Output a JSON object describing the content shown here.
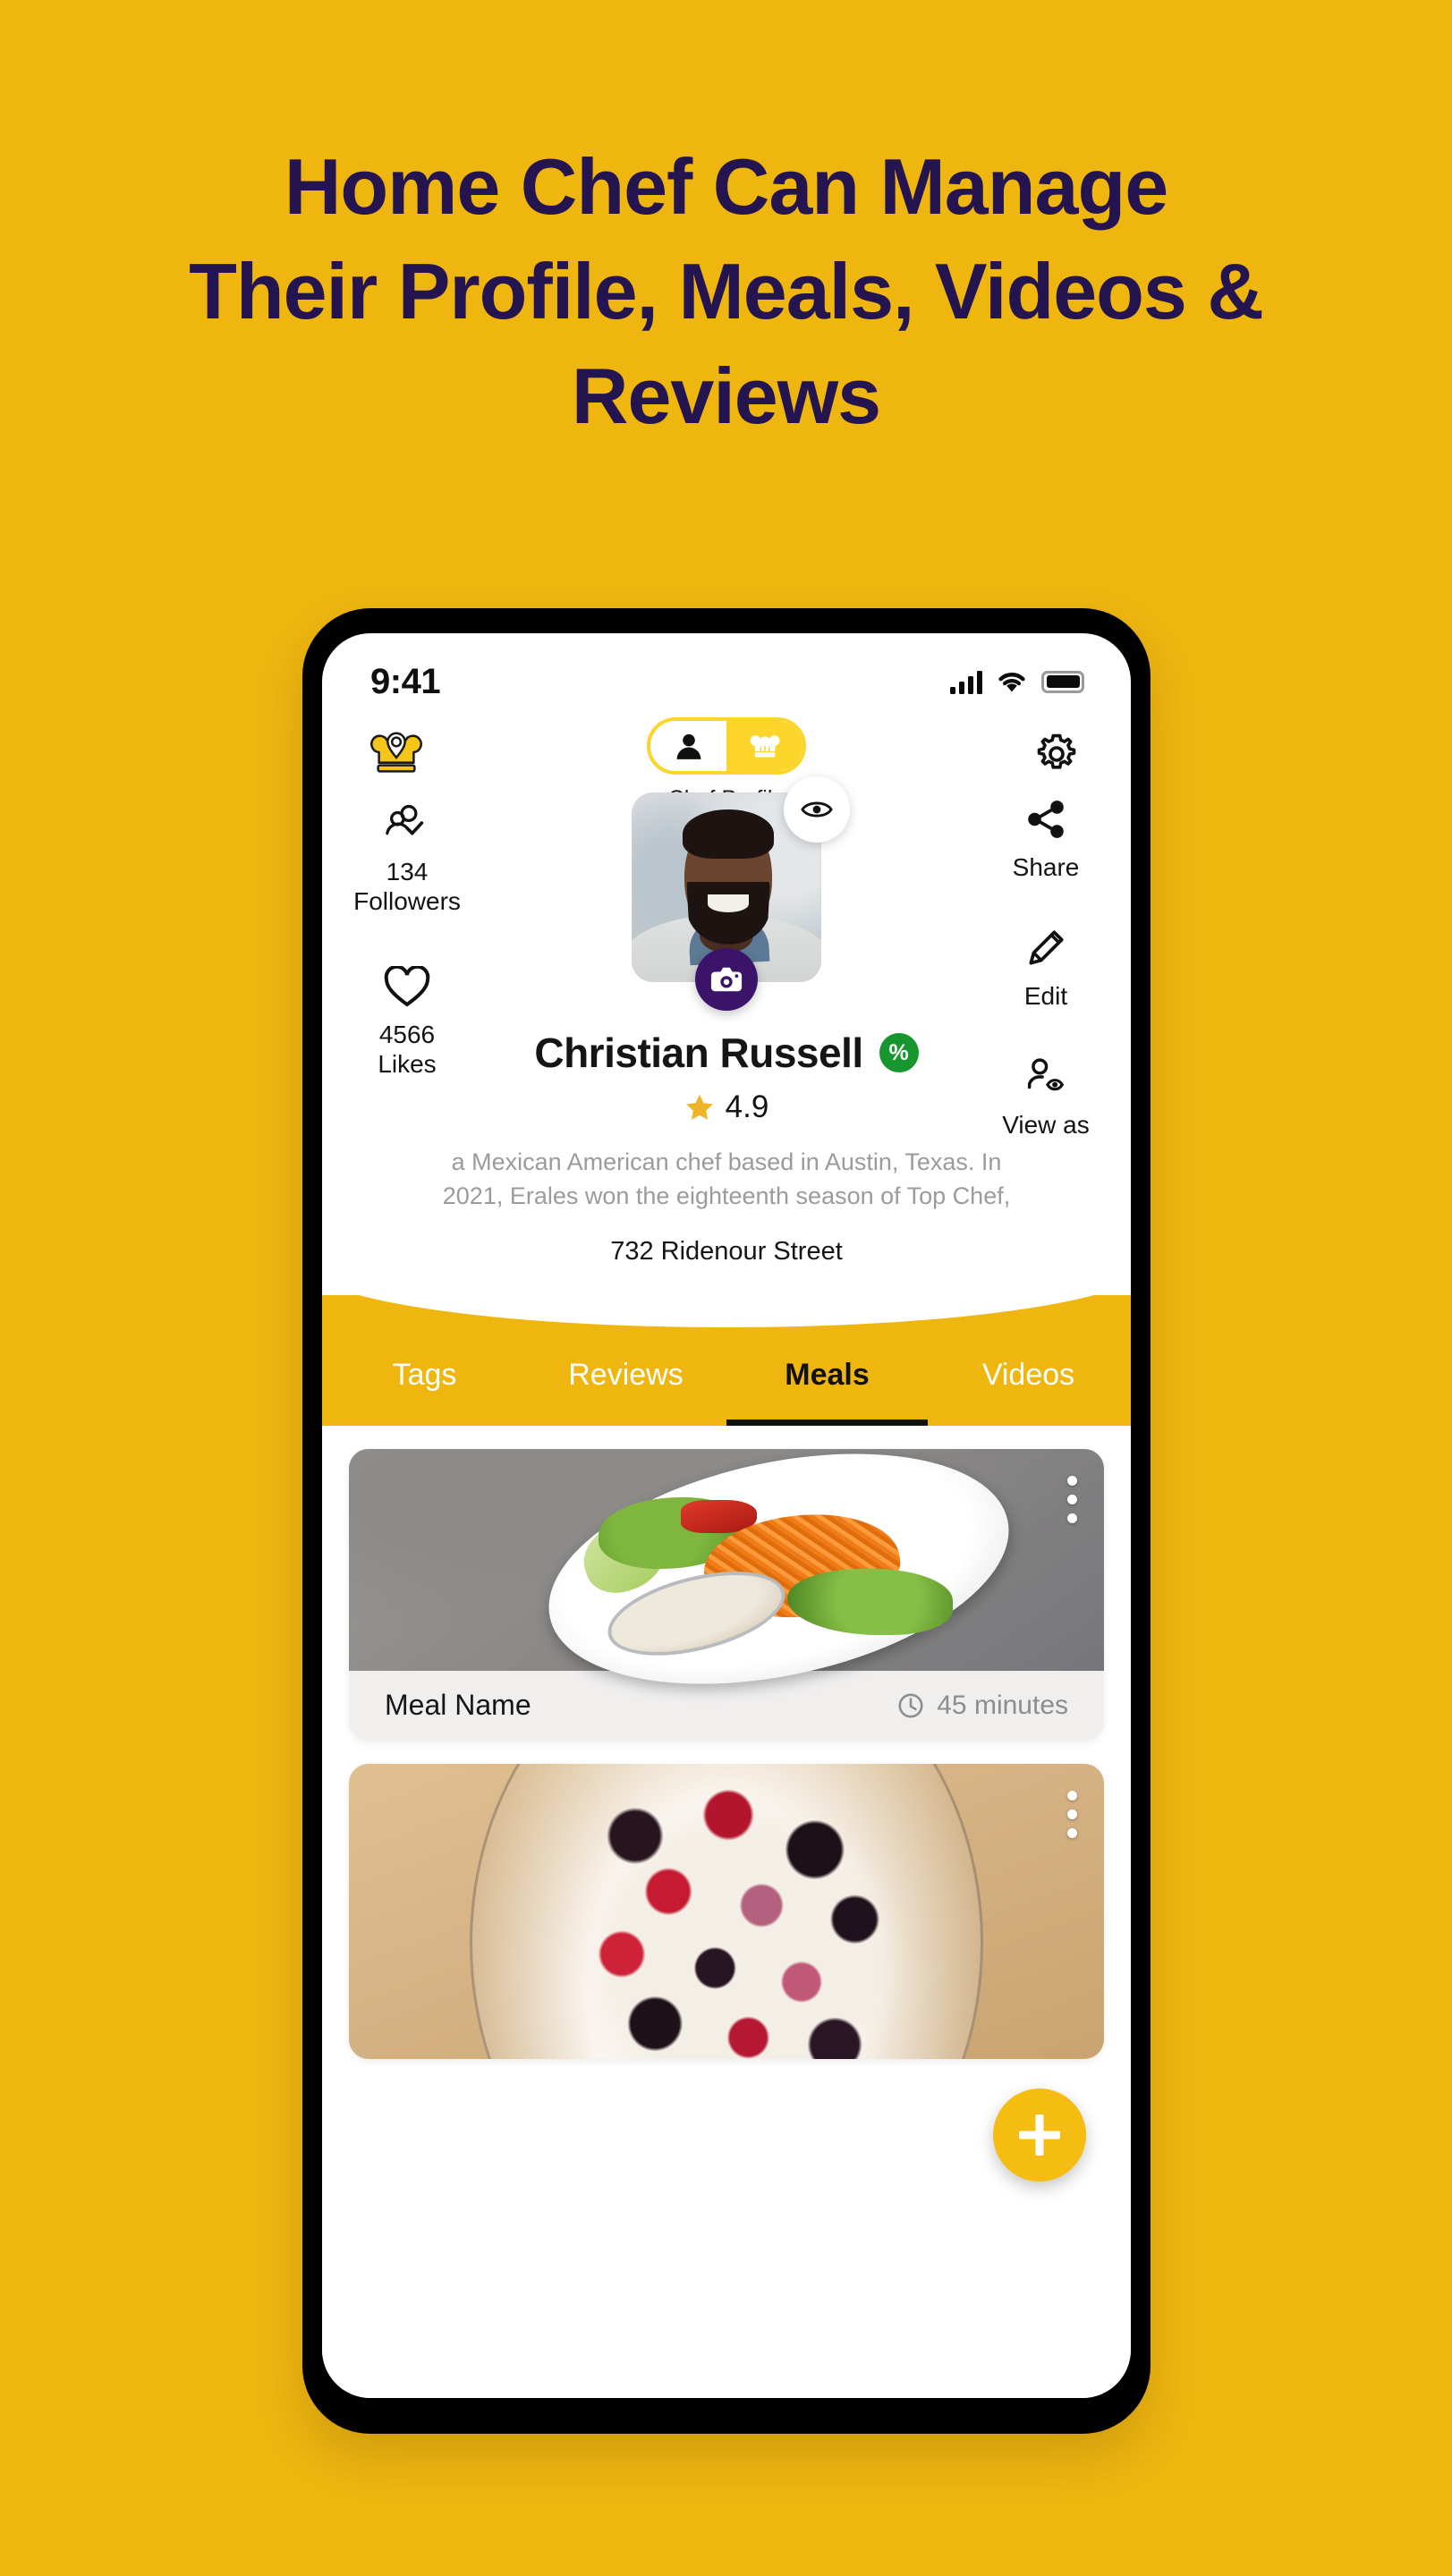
{
  "headline": {
    "line1": "Home Chef Can Manage",
    "line2": "Their Profile, Meals, Videos &",
    "line3": "Reviews"
  },
  "colors": {
    "background": "#efb610",
    "headline_text": "#241551",
    "accent_yellow": "#f5bd12",
    "toggle_yellow": "#fbd52a",
    "camera_purple": "#3b1368",
    "discount_green": "#17962f",
    "star_gold": "#f0b429"
  },
  "phone": {
    "status_bar": {
      "time": "9:41",
      "signal_icon": "cellular-bars-icon",
      "wifi_icon": "wifi-icon",
      "battery_icon": "battery-icon"
    },
    "header": {
      "logo_icon": "chef-hat-location-logo-icon",
      "settings_icon": "gear-icon",
      "toggle": {
        "user_icon": "person-icon",
        "chef_icon": "chef-hat-icon",
        "selected": "chef",
        "label": "Chef Profile"
      }
    },
    "stats": [
      {
        "icon": "followers-check-icon",
        "value": "134",
        "label": "Followers"
      },
      {
        "icon": "heart-icon",
        "value": "4566",
        "label": "Likes"
      }
    ],
    "actions": [
      {
        "icon": "share-icon",
        "label": "Share"
      },
      {
        "icon": "pencil-edit-icon",
        "label": "Edit"
      },
      {
        "icon": "person-eye-icon",
        "label": "View as"
      }
    ],
    "profile": {
      "avatar_alt": "chef-avatar-photo",
      "preview_icon": "eye-icon",
      "camera_icon": "camera-icon",
      "name": "Christian Russell",
      "badge": "%",
      "star_icon": "star-icon",
      "rating": "4.9",
      "bio": "a Mexican American chef based in Austin, Texas. In 2021, Erales won the eighteenth season of Top Chef,",
      "address": "732  Ridenour Street"
    },
    "tabs": [
      {
        "label": "Tags",
        "active": false
      },
      {
        "label": "Reviews",
        "active": false
      },
      {
        "label": "Meals",
        "active": true
      },
      {
        "label": "Videos",
        "active": false
      }
    ],
    "meals": [
      {
        "image_alt": "salad-plate-photo",
        "name": "Meal Name",
        "duration": "45 minutes",
        "clock_icon": "clock-icon",
        "menu_icon": "kebab-menu-icon"
      },
      {
        "image_alt": "berries-bowl-photo",
        "name": "",
        "duration": "",
        "clock_icon": "clock-icon",
        "menu_icon": "kebab-menu-icon"
      }
    ],
    "fab": {
      "icon": "plus-icon",
      "label": "Add meal"
    }
  }
}
